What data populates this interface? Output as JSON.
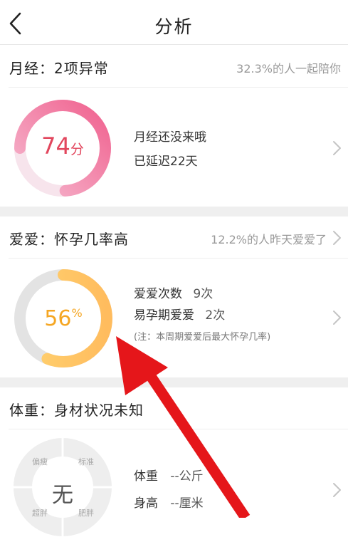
{
  "header": {
    "title": "分析",
    "back_icon": "chevron-left-icon"
  },
  "menstruation": {
    "title": "月经：2项异常",
    "stat": "32.3%的人一起陪你",
    "score_value": "74",
    "score_unit": "分",
    "score": 74,
    "line1": "月经还没来哦",
    "line2": "已延迟22天",
    "colors": {
      "ring": "#f06a95",
      "track": "#f7e2ea",
      "text": "#e2465d"
    }
  },
  "love": {
    "title": "爱爱：怀孕几率高",
    "stat": "12.2%的人昨天爱爱了",
    "percent_value": "56",
    "percent_unit": "%",
    "percent": 56,
    "count_label": "爱爱次数",
    "count_value": "9次",
    "fertile_label": "易孕期爱爱",
    "fertile_value": "2次",
    "note": "(注：本周期爱爱后最大怀孕几率)",
    "colors": {
      "ring": "#ffc465",
      "track": "#e3e3e3",
      "text": "#f5a623"
    }
  },
  "weight": {
    "title": "体重：身材状况未知",
    "center": "无",
    "segments": [
      "偏瘦",
      "标准",
      "肥胖",
      "超胖"
    ],
    "weight_label": "体重",
    "weight_value": "--公斤",
    "height_label": "身高",
    "height_value": "--厘米"
  },
  "annotation": {
    "color": "#e5161a"
  }
}
